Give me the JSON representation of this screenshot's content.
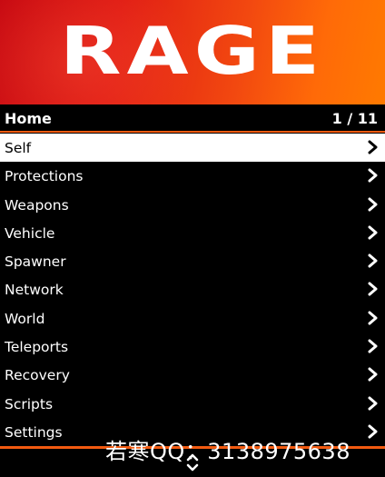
{
  "header": {
    "logo_text": "RAGE",
    "gradient_colors": [
      "#c80a12",
      "#ff7a00"
    ]
  },
  "subheader": {
    "title": "Home",
    "counter": "1 / 11"
  },
  "menu": {
    "selected_index": 0,
    "items": [
      {
        "label": "Self",
        "icon": "chevron-right-icon"
      },
      {
        "label": "Protections",
        "icon": "chevron-right-icon"
      },
      {
        "label": "Weapons",
        "icon": "chevron-right-icon"
      },
      {
        "label": "Vehicle",
        "icon": "chevron-right-icon"
      },
      {
        "label": "Spawner",
        "icon": "chevron-right-icon"
      },
      {
        "label": "Network",
        "icon": "chevron-right-icon"
      },
      {
        "label": "World",
        "icon": "chevron-right-icon"
      },
      {
        "label": "Teleports",
        "icon": "chevron-right-icon"
      },
      {
        "label": "Recovery",
        "icon": "chevron-right-icon"
      },
      {
        "label": "Scripts",
        "icon": "chevron-right-icon"
      },
      {
        "label": "Settings",
        "icon": "chevron-right-icon"
      }
    ]
  },
  "footer": {
    "scroll_icon": "up-down-arrows-icon",
    "accent_color": "#f25a10"
  },
  "watermark": {
    "text": "若寒QQ：3138975638"
  }
}
